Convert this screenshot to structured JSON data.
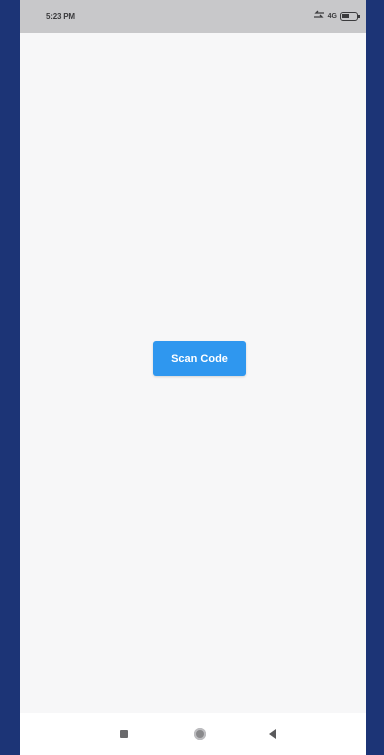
{
  "status_bar": {
    "time": "5:23 PM",
    "network": "4G",
    "icons": [
      "signal-icon",
      "battery-icon"
    ]
  },
  "main": {
    "scan_button_label": "Scan Code"
  },
  "nav_bar": {
    "icons": [
      "recents-icon",
      "home-icon",
      "back-icon"
    ]
  },
  "colors": {
    "frame_background": "#1d3577",
    "screen_background": "#f7f7f8",
    "status_bar_background": "#c8c8ca",
    "accent_button": "#2f97ef",
    "nav_bar_background": "#ffffff"
  }
}
